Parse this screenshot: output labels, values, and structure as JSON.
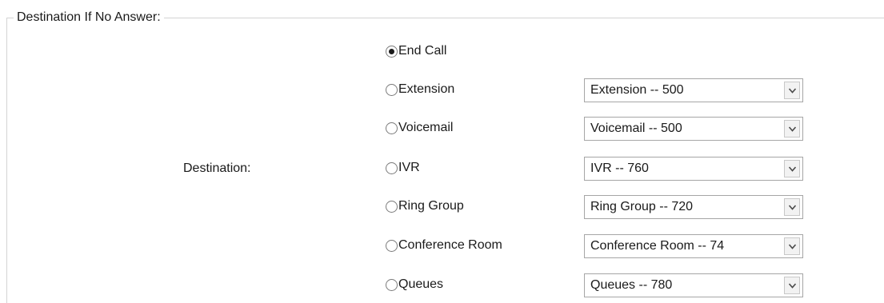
{
  "fieldset": {
    "legend": "Destination If No Answer:"
  },
  "destination_label": "Destination:",
  "options": [
    {
      "label": "End Call",
      "checked": true
    },
    {
      "label": "Extension",
      "checked": false,
      "select_value": "Extension -- 500"
    },
    {
      "label": "Voicemail",
      "checked": false,
      "select_value": "Voicemail -- 500"
    },
    {
      "label": "IVR",
      "checked": false,
      "select_value": "IVR -- 760"
    },
    {
      "label": "Ring Group",
      "checked": false,
      "select_value": "Ring Group -- 720"
    },
    {
      "label": "Conference Room",
      "checked": false,
      "select_value": "Conference Room -- 74"
    },
    {
      "label": "Queues",
      "checked": false,
      "select_value": "Queues -- 780"
    }
  ],
  "icons": {
    "dropdown": "chevron-down-icon",
    "radio": "radio-button-icon"
  },
  "colors": {
    "border": "#a6a6a6",
    "fieldset_border": "#d4d4d4",
    "text": "#1a1a1a"
  }
}
